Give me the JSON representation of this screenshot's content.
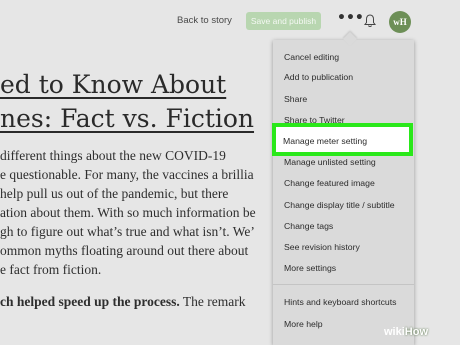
{
  "topbar": {
    "back_label": "Back to story",
    "publish_label": "Save and publish",
    "more_icon": "more-icon",
    "bell_icon": "bell-icon",
    "avatar_initials": "wH"
  },
  "article": {
    "title_line1": "ed to Know About",
    "title_line2": "nes: Fact vs. Fiction",
    "para_lines": [
      " different things about the new COVID-19",
      "e questionable. For many, the vaccines a brillia",
      "help pull us out of the pandemic, but there",
      "ation about them. With so much information be",
      "gh to figure out what’s true and what isn’t. We’",
      "ommon myths floating around out there about",
      "e fact from fiction."
    ],
    "bold_line_bold": "ch helped speed up the process.",
    "bold_line_rest": " The remark"
  },
  "menu": {
    "items": [
      "Cancel editing",
      "Add to publication",
      "Share",
      "Share to Twitter",
      "Manage meter setting",
      "Manage unlisted setting",
      "Change featured image",
      "Change display title / subtitle",
      "Change tags",
      "See revision history",
      "More settings"
    ],
    "footer_items": [
      "Hints and keyboard shortcuts",
      "More help"
    ]
  },
  "colors": {
    "highlight": "#2ae81a",
    "publish_bg": "#b8d6b0"
  },
  "watermark": {
    "wiki": "wiki",
    "how": "How"
  }
}
